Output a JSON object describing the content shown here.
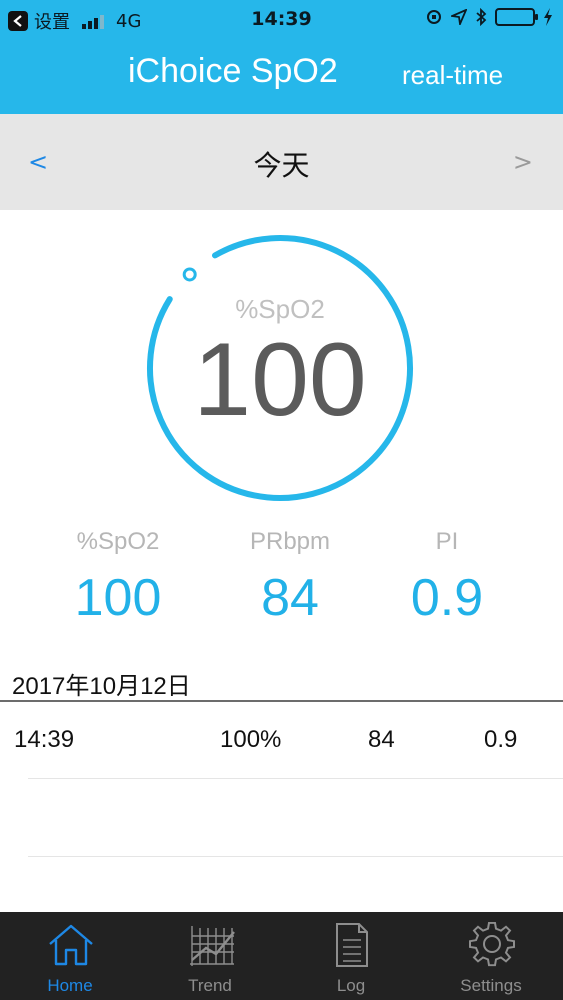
{
  "status_bar": {
    "carrier": "设置",
    "network": "4G",
    "time": "14:39",
    "battery_level": 1.0
  },
  "header": {
    "title": "iChoice SpO2",
    "subtitle": "real-time"
  },
  "date_nav": {
    "prev": "<",
    "day": "今天",
    "next": ">"
  },
  "gauge": {
    "label": "%SpO2",
    "value": "100",
    "fill_fraction": 1.0,
    "color": "#26b7ea"
  },
  "metrics": [
    {
      "label": "%SpO2",
      "value": "100"
    },
    {
      "label": "PRbpm",
      "value": "84"
    },
    {
      "label": "PI",
      "value": "0.9"
    }
  ],
  "log": {
    "date": "2017年10月12日",
    "rows": [
      {
        "time": "14:39",
        "spo2": "100%",
        "pr": "84",
        "pi": "0.9"
      }
    ]
  },
  "tab_bar": {
    "tabs": [
      {
        "label": "Home",
        "icon": "home-icon",
        "active": true
      },
      {
        "label": "Trend",
        "icon": "trend-chart-icon",
        "active": false
      },
      {
        "label": "Log",
        "icon": "log-document-icon",
        "active": false
      },
      {
        "label": "Settings",
        "icon": "gear-icon",
        "active": false
      }
    ],
    "active_color": "#1e88e5"
  }
}
